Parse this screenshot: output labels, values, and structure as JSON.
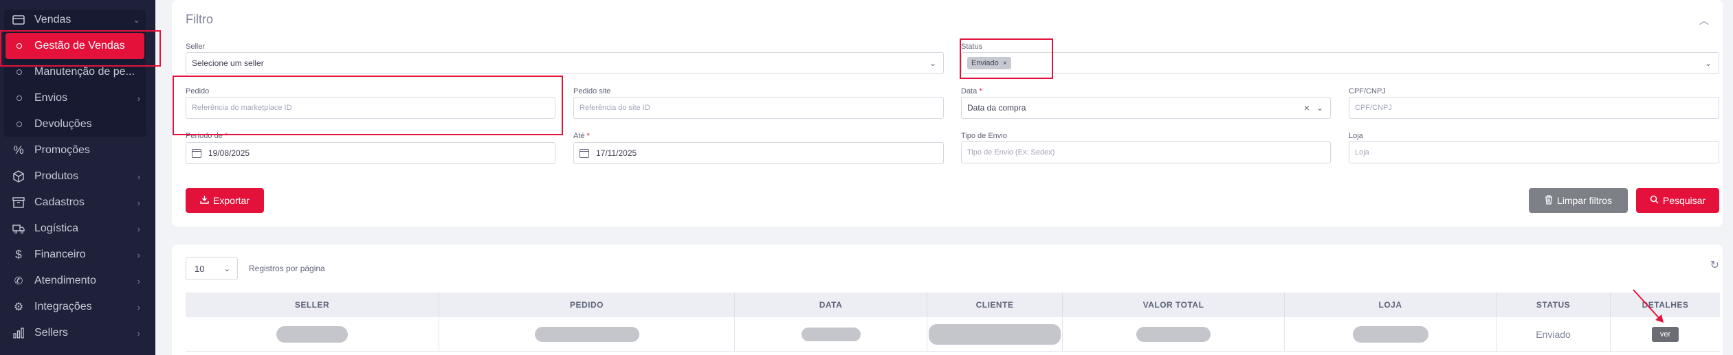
{
  "sidebar": {
    "items": [
      {
        "label": "Vendas",
        "icon": "card-icon",
        "expanded": true
      },
      {
        "label": "Gestão de Vendas",
        "active": true
      },
      {
        "label": "Manutenção de pe..."
      },
      {
        "label": "Envios"
      },
      {
        "label": "Devoluções"
      },
      {
        "label": "Promoções",
        "icon": "percent-icon"
      },
      {
        "label": "Produtos",
        "icon": "box-icon"
      },
      {
        "label": "Cadastros",
        "icon": "archive-icon"
      },
      {
        "label": "Logística",
        "icon": "truck-icon"
      },
      {
        "label": "Financeiro",
        "icon": "dollar-icon"
      },
      {
        "label": "Atendimento",
        "icon": "phone-icon"
      },
      {
        "label": "Integrações",
        "icon": "gear-icon"
      },
      {
        "label": "Sellers",
        "icon": "bar-chart-icon"
      }
    ]
  },
  "filter": {
    "title": "Filtro",
    "seller": {
      "label": "Seller",
      "placeholder": "Selecione um seller"
    },
    "status": {
      "label": "Status",
      "tag": "Enviado"
    },
    "pedido": {
      "label": "Pedido",
      "placeholder": "Referência do marketplace ID"
    },
    "pedido_site": {
      "label": "Pedido site",
      "placeholder": "Referência do site ID"
    },
    "data": {
      "label": "Data",
      "value": "Data da compra"
    },
    "cpf": {
      "label": "CPF/CNPJ",
      "placeholder": "CPF/CNPJ"
    },
    "periodo_de": {
      "label": "Período de",
      "value": "19/08/2025"
    },
    "ate": {
      "label": "Até",
      "value": "17/11/2025"
    },
    "tipo_envio": {
      "label": "Tipo de Envio",
      "placeholder": "Tipo de Envio (Ex: Sedex)"
    },
    "loja": {
      "label": "Loja",
      "placeholder": "Loja"
    },
    "required_mark": "*",
    "export_label": "Exportar",
    "clear_label": "Limpar filtros",
    "search_label": "Pesquisar"
  },
  "table": {
    "per_page_value": "10",
    "per_page_label": "Registros por página",
    "columns": [
      "SELLER",
      "PEDIDO",
      "DATA",
      "CLIENTE",
      "VALOR TOTAL",
      "LOJA",
      "STATUS",
      "DETALHES"
    ],
    "rows": [
      {
        "status": "Enviado",
        "action": "ver"
      }
    ]
  },
  "colors": {
    "accent": "#e4123b",
    "sidebar": "#1e2139",
    "gray_button": "#7e8088"
  }
}
